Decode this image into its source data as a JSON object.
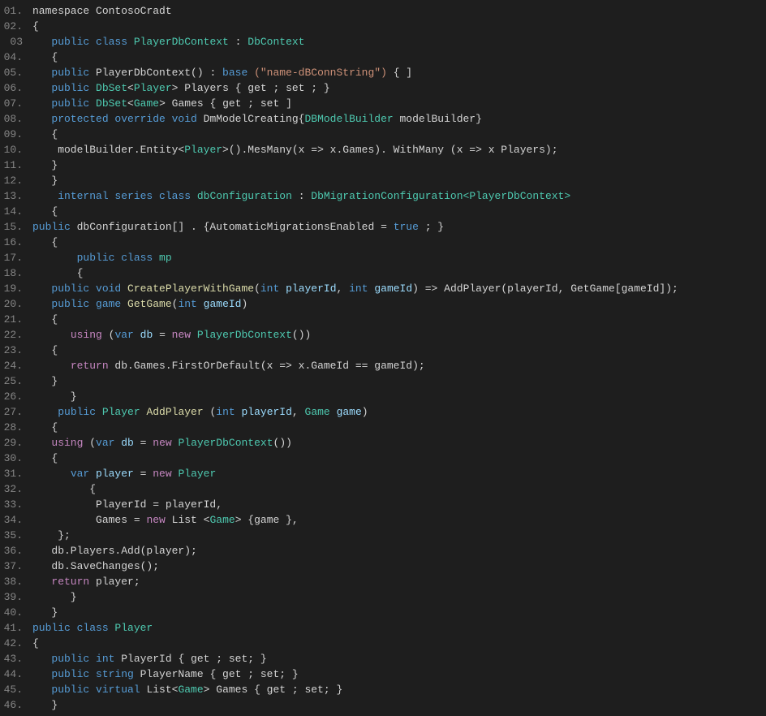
{
  "editor": {
    "background": "#1e1e1e",
    "lines": [
      {
        "num": "01.",
        "content": [
          {
            "t": "plain",
            "v": "namespace ContosoC"
          },
          {
            "t": "plain",
            "v": "radt"
          }
        ]
      },
      {
        "num": "02.",
        "content": [
          {
            "t": "plain",
            "v": "{"
          }
        ]
      },
      {
        "num": "03",
        "content": [
          {
            "t": "plain",
            "v": "   "
          },
          {
            "t": "kw",
            "v": "public class "
          },
          {
            "t": "type",
            "v": "PlayerDbContext"
          },
          {
            "t": "plain",
            "v": " : "
          },
          {
            "t": "type",
            "v": "DbContext"
          }
        ]
      },
      {
        "num": "04.",
        "content": [
          {
            "t": "plain",
            "v": "   {"
          }
        ]
      },
      {
        "num": "05.",
        "content": [
          {
            "t": "plain",
            "v": "   "
          },
          {
            "t": "kw",
            "v": "public "
          },
          {
            "t": "plain",
            "v": "PlayerDbContext() : "
          },
          {
            "t": "kw",
            "v": "base "
          },
          {
            "t": "str",
            "v": "(\"name-dBConnString\")"
          },
          {
            "t": "plain",
            "v": " { ]"
          }
        ]
      },
      {
        "num": "06.",
        "content": [
          {
            "t": "plain",
            "v": "   "
          },
          {
            "t": "kw",
            "v": "public "
          },
          {
            "t": "type",
            "v": "DbSet"
          },
          {
            "t": "plain",
            "v": "<"
          },
          {
            "t": "type",
            "v": "Player"
          },
          {
            "t": "plain",
            "v": "> Players { get ; set ; }"
          }
        ]
      },
      {
        "num": "07.",
        "content": [
          {
            "t": "plain",
            "v": "   "
          },
          {
            "t": "kw",
            "v": "public "
          },
          {
            "t": "type",
            "v": "DbSet"
          },
          {
            "t": "plain",
            "v": "<"
          },
          {
            "t": "type",
            "v": "Game"
          },
          {
            "t": "plain",
            "v": "> Games { get ; set ]"
          }
        ]
      },
      {
        "num": "08.",
        "content": [
          {
            "t": "plain",
            "v": "   "
          },
          {
            "t": "kw",
            "v": "protected override void "
          },
          {
            "t": "plain",
            "v": "DmModelCreating{"
          },
          {
            "t": "type",
            "v": "DBModelBuilder"
          },
          {
            "t": "plain",
            "v": " modelBuilder}"
          }
        ]
      },
      {
        "num": "09.",
        "content": [
          {
            "t": "plain",
            "v": "   {"
          }
        ]
      },
      {
        "num": "10.",
        "content": [
          {
            "t": "plain",
            "v": "    modelBuilder.Entity<"
          },
          {
            "t": "type",
            "v": "Player"
          },
          {
            "t": "plain",
            "v": ">().MesMany(x => x.Games). WithMany (x => x Players);"
          }
        ]
      },
      {
        "num": "11.",
        "content": [
          {
            "t": "plain",
            "v": "   }"
          }
        ]
      },
      {
        "num": "12.",
        "content": [
          {
            "t": "plain",
            "v": "   }"
          }
        ]
      },
      {
        "num": "13.",
        "content": [
          {
            "t": "plain",
            "v": "    "
          },
          {
            "t": "kw",
            "v": "internal series class "
          },
          {
            "t": "type",
            "v": "dbConfiguration"
          },
          {
            "t": "plain",
            "v": " : "
          },
          {
            "t": "type",
            "v": "DbMigrationConfiguration<PlayerDbContext>"
          }
        ]
      },
      {
        "num": "14.",
        "content": [
          {
            "t": "plain",
            "v": "   {"
          }
        ]
      },
      {
        "num": "15.",
        "content": [
          {
            "t": "kw",
            "v": "public "
          },
          {
            "t": "plain",
            "v": "dbConfiguration[] . {AutomaticMigrationsEnabled = "
          },
          {
            "t": "kw",
            "v": "true"
          },
          {
            "t": "plain",
            "v": " ; }"
          }
        ]
      },
      {
        "num": "16.",
        "content": [
          {
            "t": "plain",
            "v": "   {"
          }
        ]
      },
      {
        "num": "17.",
        "content": [
          {
            "t": "plain",
            "v": "       "
          },
          {
            "t": "kw",
            "v": "public class "
          },
          {
            "t": "type",
            "v": "mp"
          }
        ]
      },
      {
        "num": "18.",
        "content": [
          {
            "t": "plain",
            "v": "       {"
          }
        ]
      },
      {
        "num": "19.",
        "content": [
          {
            "t": "plain",
            "v": "   "
          },
          {
            "t": "kw",
            "v": "public void "
          },
          {
            "t": "method",
            "v": "CreatePlayerWithGame"
          },
          {
            "t": "plain",
            "v": "("
          },
          {
            "t": "kw",
            "v": "int "
          },
          {
            "t": "param",
            "v": "playerId"
          },
          {
            "t": "plain",
            "v": ", "
          },
          {
            "t": "kw",
            "v": "int "
          },
          {
            "t": "param",
            "v": "gameId"
          },
          {
            "t": "plain",
            "v": ") => AddPlayer(playerId, GetGame[gameId]);"
          }
        ]
      },
      {
        "num": "20.",
        "content": [
          {
            "t": "plain",
            "v": "   "
          },
          {
            "t": "kw",
            "v": "public game "
          },
          {
            "t": "method",
            "v": "GetGame"
          },
          {
            "t": "plain",
            "v": "("
          },
          {
            "t": "kw",
            "v": "int "
          },
          {
            "t": "param",
            "v": "gameId"
          },
          {
            "t": "plain",
            "v": ")"
          }
        ]
      },
      {
        "num": "21.",
        "content": [
          {
            "t": "plain",
            "v": "   {"
          }
        ]
      },
      {
        "num": "22.",
        "content": [
          {
            "t": "plain",
            "v": "      "
          },
          {
            "t": "kw2",
            "v": "using"
          },
          {
            "t": "plain",
            "v": " ("
          },
          {
            "t": "kw",
            "v": "var "
          },
          {
            "t": "param",
            "v": "db"
          },
          {
            "t": "plain",
            "v": " = "
          },
          {
            "t": "kw2",
            "v": "new "
          },
          {
            "t": "type",
            "v": "PlayerDbContext"
          },
          {
            "t": "plain",
            "v": "())"
          }
        ]
      },
      {
        "num": "23.",
        "content": [
          {
            "t": "plain",
            "v": "   {"
          }
        ]
      },
      {
        "num": "24.",
        "content": [
          {
            "t": "plain",
            "v": "      "
          },
          {
            "t": "kw2",
            "v": "return "
          },
          {
            "t": "plain",
            "v": "db.Games.FirstOrDefault(x => x.GameId == gameId);"
          }
        ]
      },
      {
        "num": "25.",
        "content": [
          {
            "t": "plain",
            "v": "   }"
          }
        ]
      },
      {
        "num": "26.",
        "content": [
          {
            "t": "plain",
            "v": "      }"
          }
        ]
      },
      {
        "num": "27.",
        "content": [
          {
            "t": "plain",
            "v": "    "
          },
          {
            "t": "kw",
            "v": "public "
          },
          {
            "t": "type",
            "v": "Player"
          },
          {
            "t": "plain",
            "v": " "
          },
          {
            "t": "method",
            "v": "AddPlayer"
          },
          {
            "t": "plain",
            "v": " ("
          },
          {
            "t": "kw",
            "v": "int "
          },
          {
            "t": "param",
            "v": "playerId"
          },
          {
            "t": "plain",
            "v": ", "
          },
          {
            "t": "type",
            "v": "Game"
          },
          {
            "t": "plain",
            "v": " "
          },
          {
            "t": "param",
            "v": "game"
          },
          {
            "t": "plain",
            "v": ")"
          }
        ]
      },
      {
        "num": "28.",
        "content": [
          {
            "t": "plain",
            "v": "   {"
          }
        ]
      },
      {
        "num": "29.",
        "content": [
          {
            "t": "plain",
            "v": "   "
          },
          {
            "t": "kw2",
            "v": "using"
          },
          {
            "t": "plain",
            "v": " ("
          },
          {
            "t": "kw",
            "v": "var "
          },
          {
            "t": "param",
            "v": "db"
          },
          {
            "t": "plain",
            "v": " = "
          },
          {
            "t": "kw2",
            "v": "new "
          },
          {
            "t": "type",
            "v": "PlayerDbContext"
          },
          {
            "t": "plain",
            "v": "())"
          }
        ]
      },
      {
        "num": "30.",
        "content": [
          {
            "t": "plain",
            "v": "   {"
          }
        ]
      },
      {
        "num": "31.",
        "content": [
          {
            "t": "plain",
            "v": "      "
          },
          {
            "t": "kw",
            "v": "var "
          },
          {
            "t": "param",
            "v": "player"
          },
          {
            "t": "plain",
            "v": " = "
          },
          {
            "t": "kw2",
            "v": "new "
          },
          {
            "t": "type",
            "v": "Player"
          }
        ]
      },
      {
        "num": "32.",
        "content": [
          {
            "t": "plain",
            "v": "         {"
          }
        ]
      },
      {
        "num": "33.",
        "content": [
          {
            "t": "plain",
            "v": "          PlayerId = playerId,"
          }
        ]
      },
      {
        "num": "34.",
        "content": [
          {
            "t": "plain",
            "v": "          Games = "
          },
          {
            "t": "kw2",
            "v": "new "
          },
          {
            "t": "plain",
            "v": "List <"
          },
          {
            "t": "type",
            "v": "Game"
          },
          {
            "t": "plain",
            "v": "> {game },"
          }
        ]
      },
      {
        "num": "35.",
        "content": [
          {
            "t": "plain",
            "v": "    };"
          }
        ]
      },
      {
        "num": "36.",
        "content": [
          {
            "t": "plain",
            "v": "   db.Players.Add(player);"
          }
        ]
      },
      {
        "num": "37.",
        "content": [
          {
            "t": "plain",
            "v": "   db.SaveChanges();"
          }
        ]
      },
      {
        "num": "38.",
        "content": [
          {
            "t": "plain",
            "v": "   "
          },
          {
            "t": "kw2",
            "v": "return"
          },
          {
            "t": "plain",
            "v": " player;"
          }
        ]
      },
      {
        "num": "39.",
        "content": [
          {
            "t": "plain",
            "v": "      }"
          }
        ]
      },
      {
        "num": "40.",
        "content": [
          {
            "t": "plain",
            "v": "   }"
          }
        ]
      },
      {
        "num": "41.",
        "content": [
          {
            "t": "kw",
            "v": "public class "
          },
          {
            "t": "type",
            "v": "Player"
          }
        ]
      },
      {
        "num": "42.",
        "content": [
          {
            "t": "plain",
            "v": "{"
          }
        ]
      },
      {
        "num": "43.",
        "content": [
          {
            "t": "plain",
            "v": "   "
          },
          {
            "t": "kw",
            "v": "public int "
          },
          {
            "t": "plain",
            "v": "PlayerId { get ; set; }"
          }
        ]
      },
      {
        "num": "44.",
        "content": [
          {
            "t": "plain",
            "v": "   "
          },
          {
            "t": "kw",
            "v": "public string "
          },
          {
            "t": "plain",
            "v": "PlayerName { get ; set; }"
          }
        ]
      },
      {
        "num": "45.",
        "content": [
          {
            "t": "plain",
            "v": "   "
          },
          {
            "t": "kw",
            "v": "public virtual "
          },
          {
            "t": "plain",
            "v": "List<"
          },
          {
            "t": "type",
            "v": "Game"
          },
          {
            "t": "plain",
            "v": "> Games { get ; set; }"
          }
        ]
      },
      {
        "num": "46.",
        "content": [
          {
            "t": "plain",
            "v": "   }"
          }
        ]
      }
    ]
  }
}
